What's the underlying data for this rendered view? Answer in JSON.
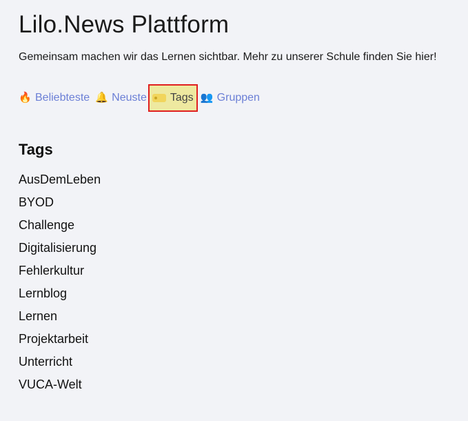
{
  "header": {
    "title": "Lilo.News Plattform",
    "tagline": "Gemeinsam machen wir das Lernen sichtbar. Mehr zu unserer Schule finden Sie hier!"
  },
  "nav": {
    "items": [
      {
        "label": "Beliebteste",
        "icon": "fire-icon",
        "glyph": "🔥"
      },
      {
        "label": "Neuste",
        "icon": "bell-icon",
        "glyph": "🔔"
      },
      {
        "label": "Tags",
        "icon": "tag-icon",
        "glyph": "",
        "active": true
      },
      {
        "label": "Gruppen",
        "icon": "people-icon",
        "glyph": "👥"
      }
    ]
  },
  "main": {
    "section_title": "Tags",
    "tags": [
      "AusDemLeben",
      "BYOD",
      "Challenge",
      "Digitalisierung",
      "Fehlerkultur",
      "Lernblog",
      "Lernen",
      "Projektarbeit",
      "Unterricht",
      "VUCA-Welt"
    ]
  },
  "colors": {
    "background": "#f2f3f7",
    "link": "#6b7fd6",
    "active_highlight": "#eee9a0",
    "active_outline": "#e02020"
  }
}
